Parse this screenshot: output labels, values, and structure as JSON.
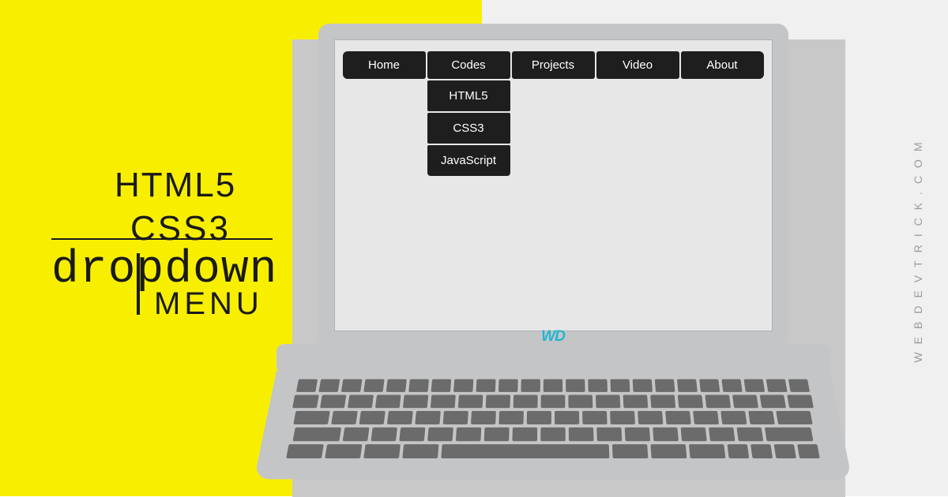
{
  "title": {
    "line1": "HTML5",
    "line2": "CSS3",
    "dropdown": "dropdown",
    "menu": "MENU"
  },
  "nav": {
    "items": [
      "Home",
      "Codes",
      "Projects",
      "Video",
      "About"
    ],
    "dropdown": [
      "HTML5",
      "CSS3",
      "JavaScript"
    ]
  },
  "logo": "WD",
  "watermark": "WEBDEVTRICK.COM"
}
